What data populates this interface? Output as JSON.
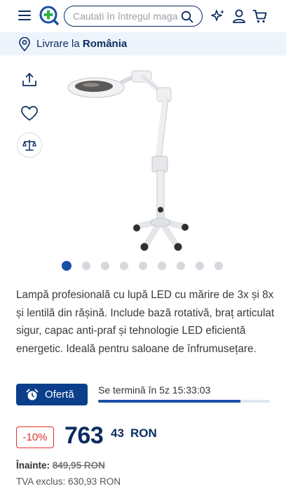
{
  "header": {
    "search_placeholder": "Cautati în întregul magazin",
    "icons": [
      "menu-icon",
      "logo-plus-icon",
      "search-icon",
      "sparkle-icon",
      "user-icon",
      "cart-icon"
    ],
    "brand_color": "#0b2c5f"
  },
  "delivery": {
    "prefix": "Livrare la",
    "country": "România"
  },
  "gallery": {
    "image_count": 9,
    "active_index": 0
  },
  "product": {
    "description": "Lampă profesională cu lupă LED cu mărire de 3x și 8x și lentilă din rășină. Include bază rotativă, braț articulat sigur, capac anti-praf și tehnologie LED eficientă energetic. Ideală pentru saloane de înfrumusețare."
  },
  "offer": {
    "button_label": "Ofertă",
    "ends_text": "Se termină în 5z 15:33:03",
    "progress_fraction": 0.83
  },
  "pricing": {
    "discount": "-10%",
    "price_integer": "763",
    "price_decimals": "43",
    "currency": "RON",
    "before_label": "Înainte:",
    "before_price": "849,95 RON",
    "vat_text": "TVA exclus: 630,93 RON"
  }
}
